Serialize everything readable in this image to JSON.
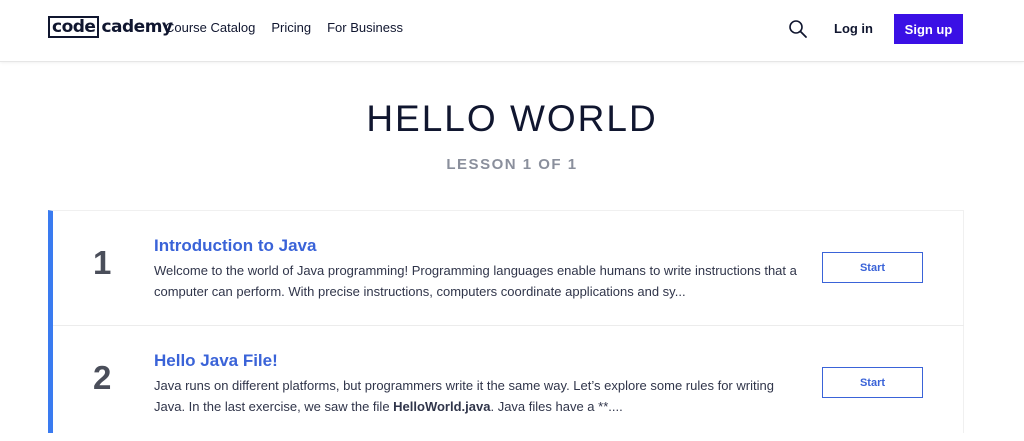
{
  "header": {
    "logo_code": "code",
    "logo_rest": "cademy",
    "nav": [
      "Course Catalog",
      "Pricing",
      "For Business"
    ],
    "search_icon": "search-icon",
    "login_label": "Log in",
    "signup_label": "Sign up",
    "accent_color": "#3a10e5"
  },
  "page": {
    "title": "HELLO WORLD",
    "lesson_count": "LESSON 1 OF 1"
  },
  "lessons": [
    {
      "number": "1",
      "title": "Introduction to Java",
      "description": "Welcome to the world of Java programming! Programming languages enable humans to write instructions that a computer can perform. With precise instructions, computers coordinate applications and sy...",
      "button": "Start"
    },
    {
      "number": "2",
      "title": "Hello Java File!",
      "description_before": "Java runs on different platforms, but programmers write it the same way. Let’s explore some rules for writing Java. In the last exercise, we saw the file ",
      "description_bold": "HelloWorld.java",
      "description_after": ". Java files have a **....",
      "button": "Start"
    }
  ],
  "colors": {
    "lesson_link": "#3a63d8",
    "progress_border": "#3a7bf0"
  }
}
